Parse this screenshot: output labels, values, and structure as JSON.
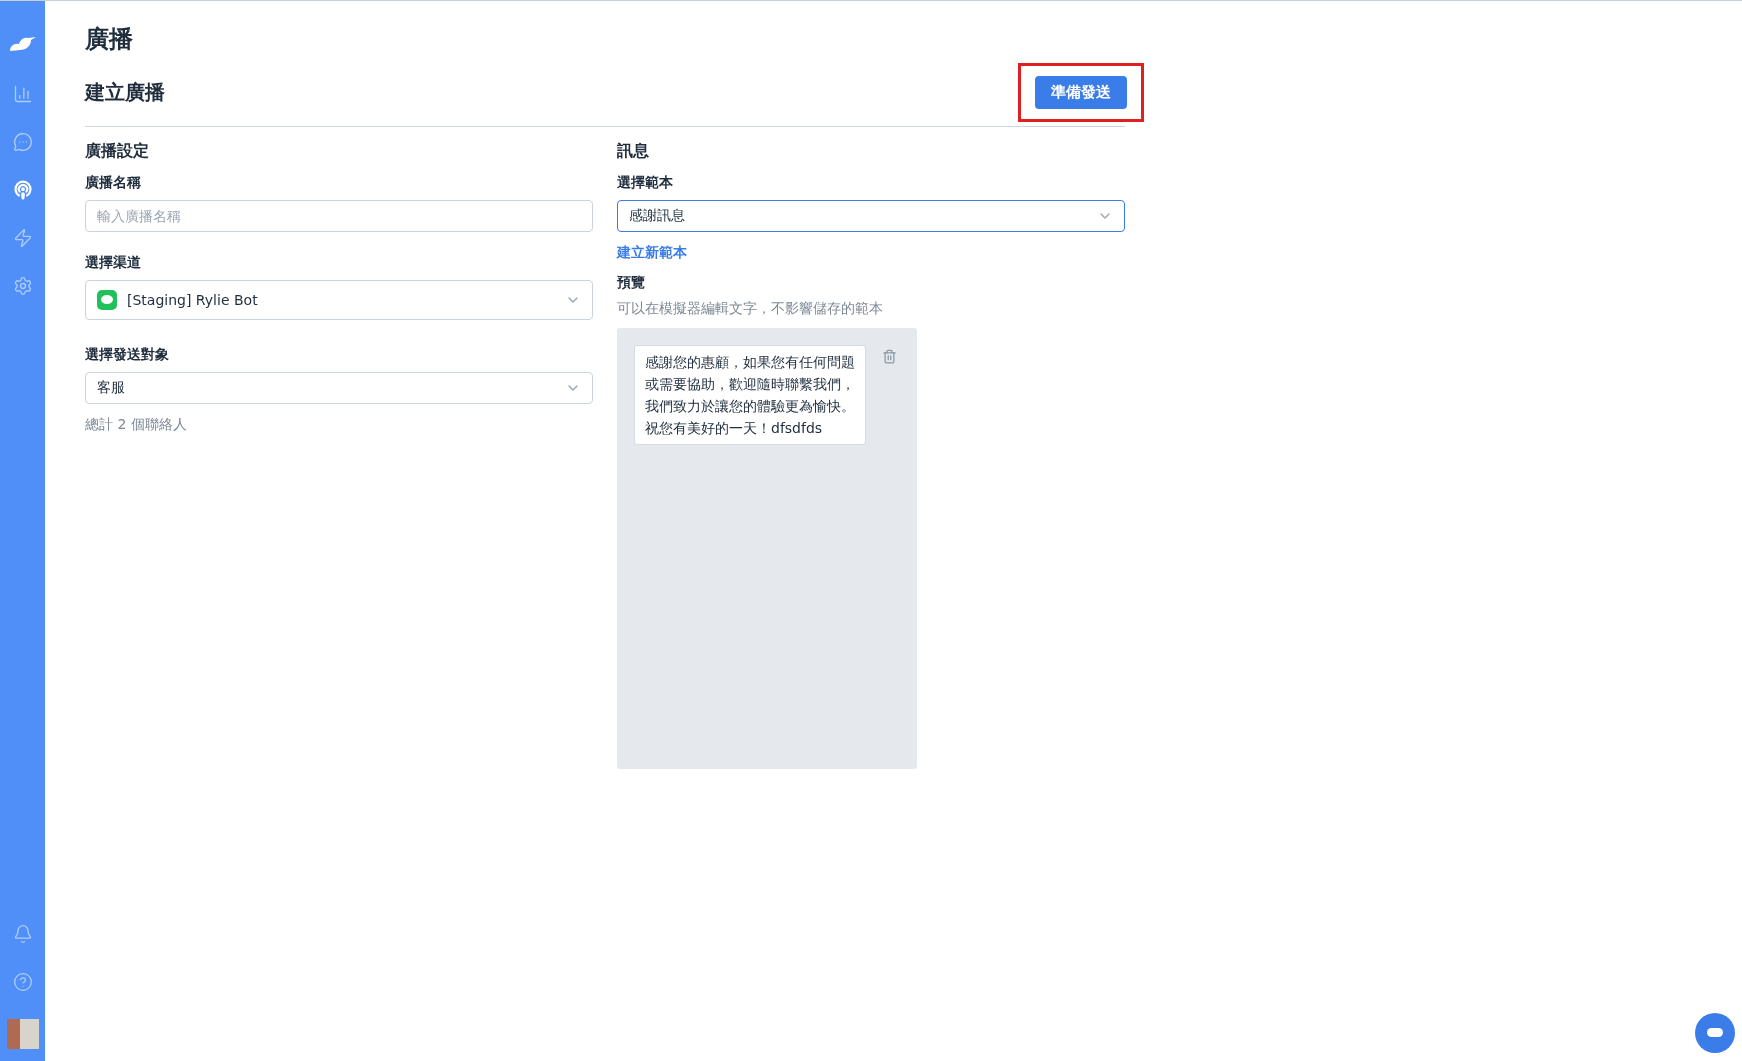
{
  "sidebar": {
    "nav": [
      {
        "selected": false
      },
      {
        "selected": false
      },
      {
        "selected": true
      },
      {
        "selected": false
      },
      {
        "selected": false
      }
    ]
  },
  "page": {
    "title": "廣播",
    "subtitle": "建立廣播",
    "action": {
      "label": "準備發送",
      "highlighted": true
    }
  },
  "settings": {
    "heading": "廣播設定",
    "name_field": {
      "label": "廣播名稱",
      "placeholder": "輸入廣播名稱"
    },
    "channel": {
      "label": "選擇渠道",
      "value": "[Staging] Rylie Bot"
    },
    "audience": {
      "label": "選擇發送對象",
      "value": "客服"
    },
    "count": "總計 2 個聯絡人"
  },
  "message": {
    "heading": "訊息",
    "template": {
      "label": "選擇範本",
      "value": "感謝訊息",
      "focused": true
    },
    "new_template_link": "建立新範本",
    "preview_label": "預覽",
    "preview_hint": "可以在模擬器編輯文字，不影響儲存的範本",
    "bubble_lines": [
      "感謝您的惠顧，如果您有任何問題",
      "或需要協助，歡迎隨時聯繫我們，",
      "我們致力於讓您的體驗更為愉快。",
      "祝您有美好的一天！dfsdfds"
    ]
  }
}
